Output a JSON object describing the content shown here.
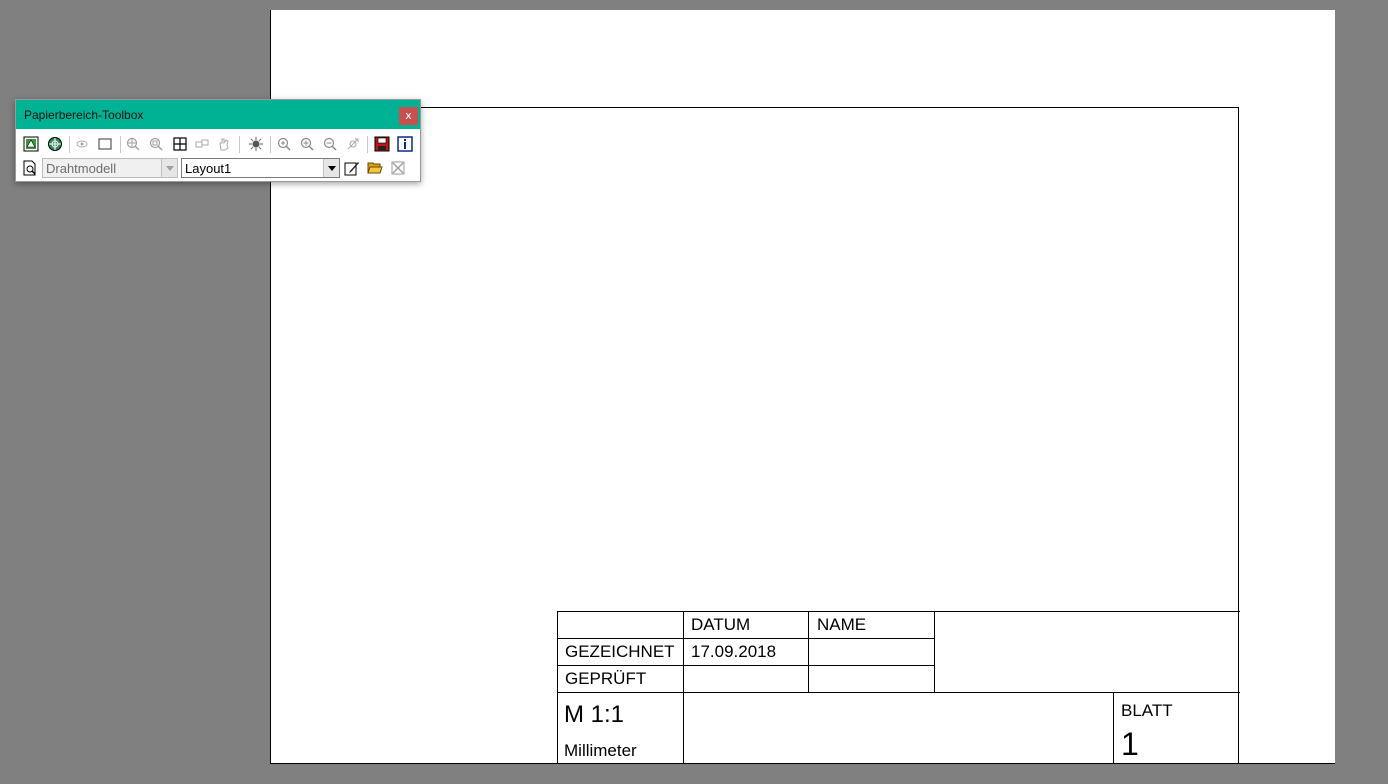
{
  "toolbox": {
    "title": "Papierbereich-Toolbox",
    "close_label": "x",
    "view_style_value": "Drahtmodell",
    "layout_value": "Layout1",
    "row1_icons": [
      "model-space-icon",
      "globe-icon",
      "eye-icon",
      "rectangle-icon",
      "zoom-window-icon",
      "zoom-extents-icon",
      "viewport-grid-icon",
      "link-viewports-icon",
      "pan-hand-icon",
      "light-icon",
      "zoom-realtime-icon",
      "zoom-in-icon",
      "zoom-out-icon",
      "orbit-icon",
      "save-icon",
      "info-icon"
    ],
    "row2_icons": [
      "print-preview-icon",
      "edit-layout-icon",
      "open-folder-icon",
      "delete-layout-icon"
    ]
  },
  "title_block": {
    "col_datum": "DATUM",
    "col_name": "NAME",
    "row_gezeichnet": "GEZEICHNET",
    "gezeichnet_datum": "17.09.2018",
    "row_geprueft": "GEPRÜFT",
    "scale": "M 1:1",
    "units": "Millimeter",
    "blatt_label": "BLATT",
    "blatt_number": "1"
  }
}
